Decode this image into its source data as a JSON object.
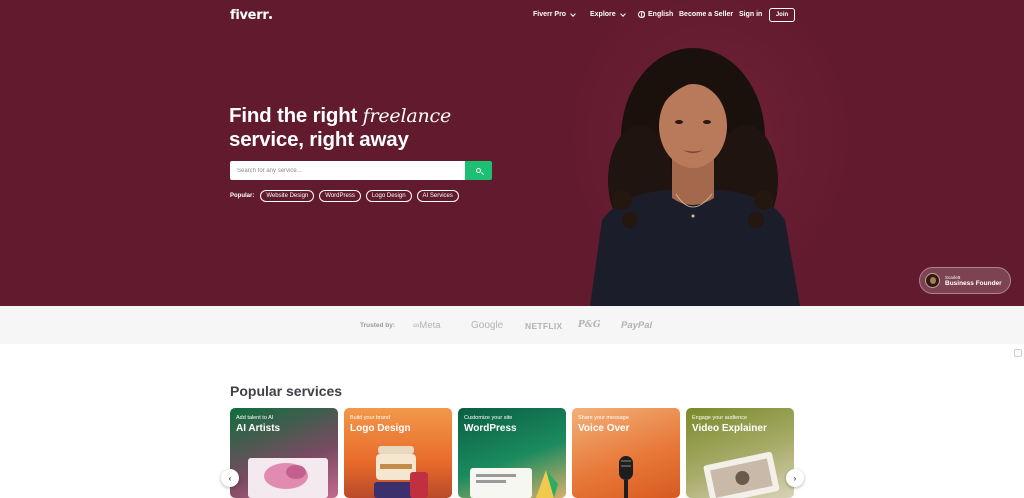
{
  "nav": {
    "logo": "fiverr",
    "fiverr_pro": "Fiverr Pro",
    "explore": "Explore",
    "language": "English",
    "become_seller": "Become a Seller",
    "sign_in": "Sign in",
    "join": "Join"
  },
  "hero": {
    "headline_line1_prefix": "Find the right ",
    "headline_line1_italic": "freelance",
    "headline_line2": "service, right away",
    "search_placeholder": "Search for any service...",
    "popular_label": "Popular:",
    "popular_chips": [
      "Website Design",
      "WordPress",
      "Logo Design",
      "AI Services"
    ],
    "badge": {
      "name": "Scarlett",
      "role": "Business Founder"
    }
  },
  "trusted": {
    "label": "Trusted by:",
    "brands": [
      "Meta",
      "Google",
      "NETFLIX",
      "P&G",
      "PayPal"
    ]
  },
  "popular_services": {
    "title": "Popular services",
    "cards": [
      {
        "subtitle": "Add talent to AI",
        "title": "AI Artists",
        "color": "#00732e"
      },
      {
        "subtitle": "Build your brand",
        "title": "Logo Design",
        "color": "#ff7640"
      },
      {
        "subtitle": "Customize your site",
        "title": "WordPress",
        "color": "#003912"
      },
      {
        "subtitle": "Share your message",
        "title": "Voice Over",
        "color": "#4d1727"
      },
      {
        "subtitle": "Engage your audience",
        "title": "Video Explainer",
        "color": "#687200"
      }
    ]
  },
  "colors": {
    "hero_bg": "#621a2e",
    "accent_green": "#1dbf73",
    "trusted_bg": "#f6f6f6"
  }
}
